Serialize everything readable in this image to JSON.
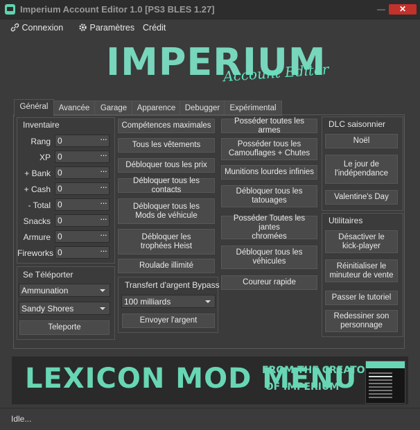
{
  "window": {
    "title": "Imperium Account Editor 1.0 [PS3 BLES 1.27]",
    "minimize": "—",
    "maximize": "□",
    "close": "✕"
  },
  "menu": {
    "connexion": "Connexion",
    "parametres": "Paramètres",
    "credit": "Crédit"
  },
  "logo": {
    "title": "IMPERIUM",
    "subtitle": "Account Editor"
  },
  "tabs": [
    "Général",
    "Avancée",
    "Garage",
    "Apparence",
    "Debugger",
    "Expérimental"
  ],
  "inventaire": {
    "title": "Inventaire",
    "fields": [
      {
        "label": "Rang",
        "value": "0"
      },
      {
        "label": "XP",
        "value": "0"
      },
      {
        "label": "+ Bank",
        "value": "0"
      },
      {
        "label": "+ Cash",
        "value": "0"
      },
      {
        "label": "- Total",
        "value": "0"
      },
      {
        "label": "Snacks",
        "value": "0"
      },
      {
        "label": "Armure",
        "value": "0"
      },
      {
        "label": "Fireworks",
        "value": "0"
      }
    ],
    "ellipsis": "···"
  },
  "teleport": {
    "title": "Se Téléporter",
    "location1": "Ammunation",
    "location2": "Sandy Shores",
    "button": "Teleporte"
  },
  "col2": {
    "buttons": [
      "Compétences maximales",
      "Tous les vêtements",
      "Débloquer tous les prix",
      "Débloquer tous les contacts",
      "Débloquer tous les\nMods de véhicule",
      "Débloquer les\ntrophées Heist",
      "Roulade illimité"
    ]
  },
  "transfert": {
    "title": "Transfert d'argent Bypass",
    "amount": "100 milliards",
    "button": "Envoyer l'argent"
  },
  "col3": {
    "buttons": [
      "Posséder toutes les armes",
      "Posséder tous les\nCamouflages + Chutes",
      "Munitions lourdes infinies",
      "Débloquer tous les\ntatouages",
      "Posséder Toutes les jantes\nchromées",
      "Débloquer tous les\nvéhicules",
      "Coureur rapide"
    ]
  },
  "dlc": {
    "title": "DLC saisonnier",
    "buttons": [
      "Noël",
      "Le jour de\nl'indépendance",
      "Valentine's Day"
    ]
  },
  "utilitaires": {
    "title": "Utilitaires",
    "buttons": [
      "Désactiver le\nkick-player",
      "Réinitialiser le\nminuteur de vente",
      "Passer le tutoriel",
      "Redessiner son\npersonnage"
    ]
  },
  "banner": {
    "title": "LEXICON MOD MENU",
    "line1": "FROM THE CREATOR",
    "line2": "OF IMPERIUM",
    "thumb_title": "LEXICON"
  },
  "status": "Idle...",
  "colors": {
    "accent": "#68d6b4",
    "background": "#3b3b3b",
    "close": "#c3312b"
  }
}
